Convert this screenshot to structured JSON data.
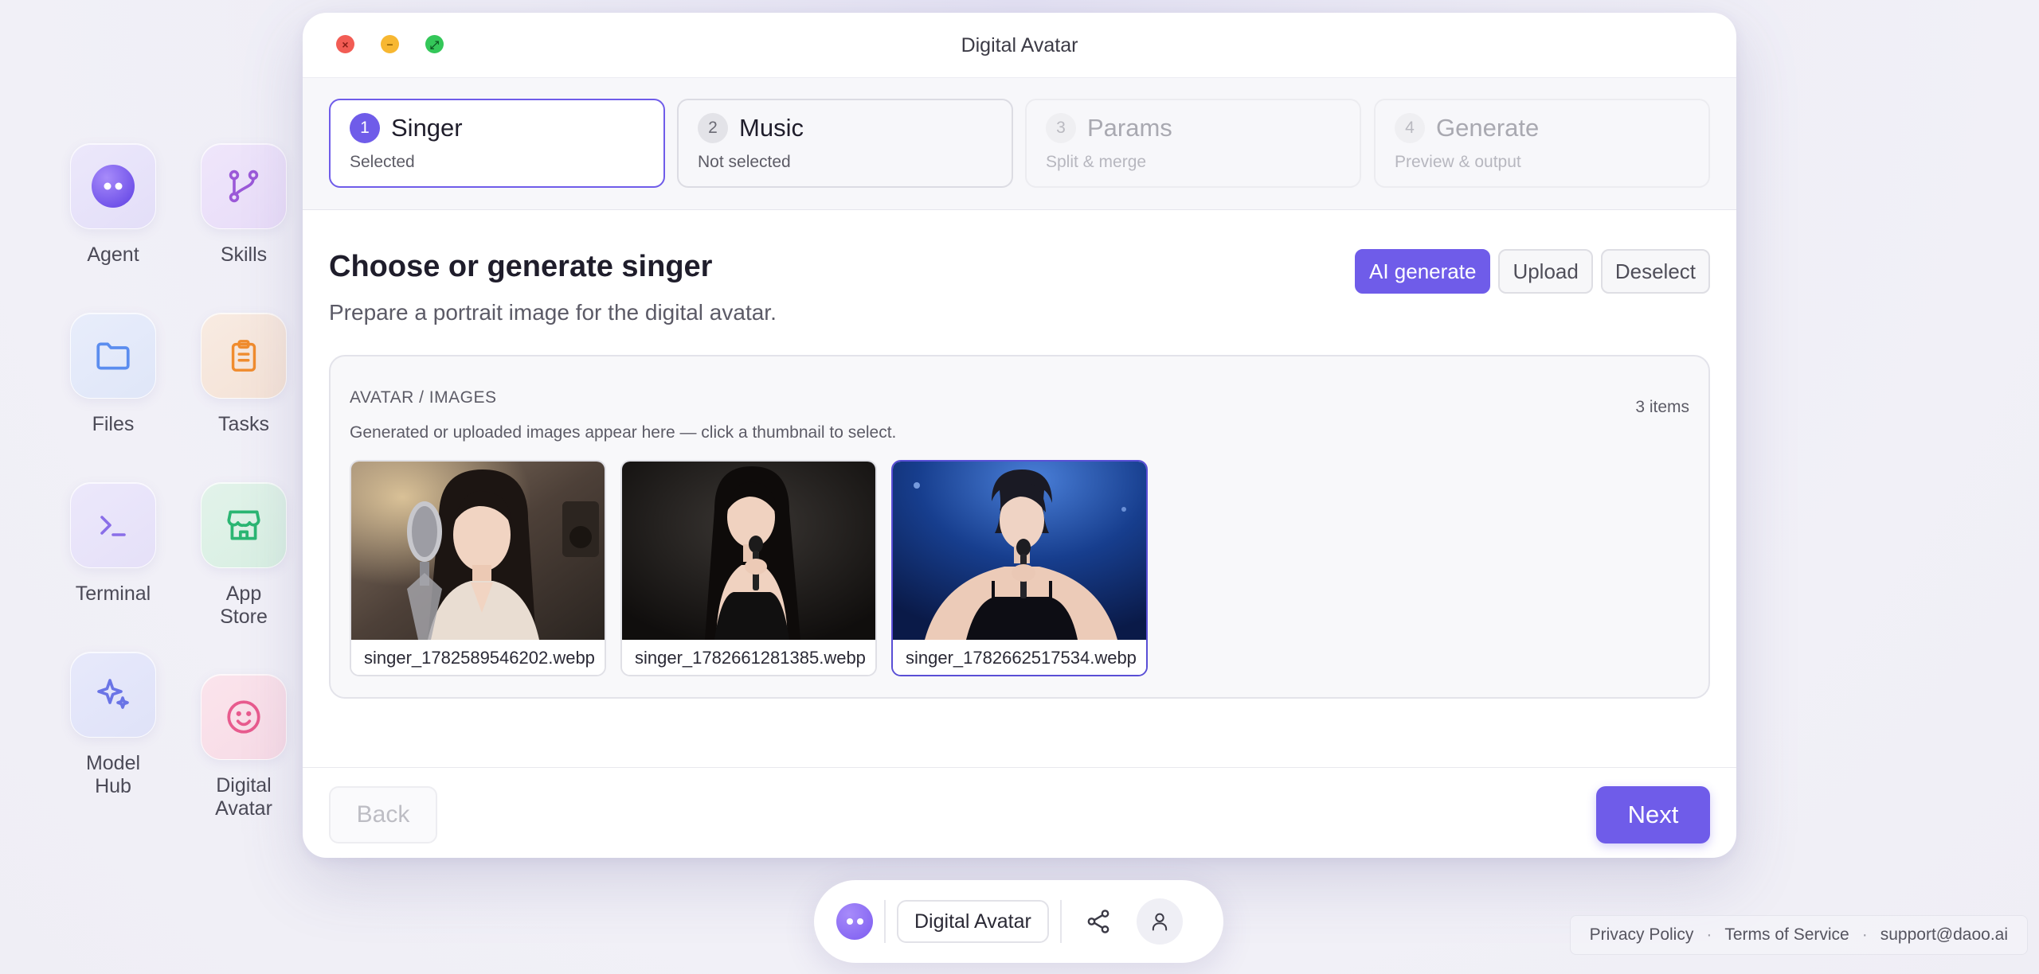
{
  "desktop": {
    "icons": [
      {
        "label": "Agent",
        "icon": "agent-logo-icon"
      },
      {
        "label": "Skills",
        "icon": "branch-icon"
      },
      {
        "label": "Files",
        "icon": "folder-icon"
      },
      {
        "label": "Tasks",
        "icon": "clipboard-icon"
      },
      {
        "label": "Terminal",
        "icon": "terminal-icon"
      },
      {
        "label": "App\nStore",
        "icon": "store-icon"
      },
      {
        "label": "Model\nHub",
        "icon": "sparkle-icon"
      },
      {
        "label": "Digital\nAvatar",
        "icon": "smiley-icon"
      }
    ]
  },
  "window": {
    "title": "Digital Avatar",
    "steps": [
      {
        "num": "1",
        "title": "Singer",
        "sub": "Selected",
        "state": "active"
      },
      {
        "num": "2",
        "title": "Music",
        "sub": "Not selected",
        "state": "normal"
      },
      {
        "num": "3",
        "title": "Params",
        "sub": "Split & merge",
        "state": "disabled"
      },
      {
        "num": "4",
        "title": "Generate",
        "sub": "Preview & output",
        "state": "disabled"
      }
    ],
    "heading": "Choose or generate singer",
    "subheading": "Prepare a portrait image for the digital avatar.",
    "actions": {
      "ai_generate": "AI generate",
      "upload": "Upload",
      "deselect": "Deselect"
    },
    "gallery": {
      "title": "AVATAR / IMAGES",
      "description": "Generated or uploaded images appear here — click a thumbnail to select.",
      "count": "3 items",
      "images": [
        {
          "filename": "singer_1782589546202.webp",
          "selected": false
        },
        {
          "filename": "singer_1782661281385.webp",
          "selected": false
        },
        {
          "filename": "singer_1782662517534.webp",
          "selected": true
        }
      ]
    },
    "back_label": "Back",
    "next_label": "Next"
  },
  "dock": {
    "app_label": "Digital Avatar",
    "icons": [
      "share-icon",
      "user-icon"
    ]
  },
  "legal": {
    "privacy": "Privacy Policy",
    "terms": "Terms of Service",
    "support": "support@daoo.ai",
    "separator": "·"
  },
  "colors": {
    "accent": "#6f5ce9",
    "traffic_close": "#f25c54",
    "traffic_min": "#f7b731",
    "traffic_max": "#34c759"
  }
}
